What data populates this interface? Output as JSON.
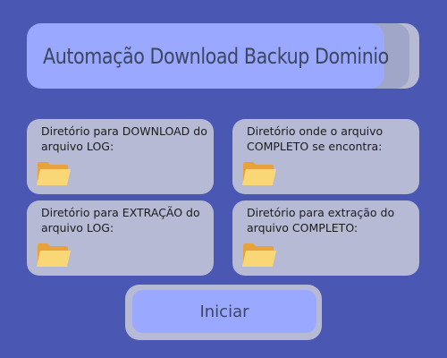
{
  "header": {
    "title": "Automação Download Backup Dominio"
  },
  "cards": [
    {
      "label": "Diretório para DOWNLOAD do arquivo LOG:",
      "icon": "folder-icon"
    },
    {
      "label": "Diretório onde o arquivo COMPLETO se encontra:",
      "icon": "folder-icon"
    },
    {
      "label": "Diretório para EXTRAÇÃO do arquivo LOG:",
      "icon": "folder-icon"
    },
    {
      "label": "Diretório para extração do arquivo COMPLETO:",
      "icon": "folder-icon"
    }
  ],
  "actions": {
    "start_label": "Iniciar"
  },
  "colors": {
    "background": "#4a58b4",
    "accent": "#9aa8ff",
    "panel": "#b6bad4",
    "folder": "#f9d776"
  }
}
